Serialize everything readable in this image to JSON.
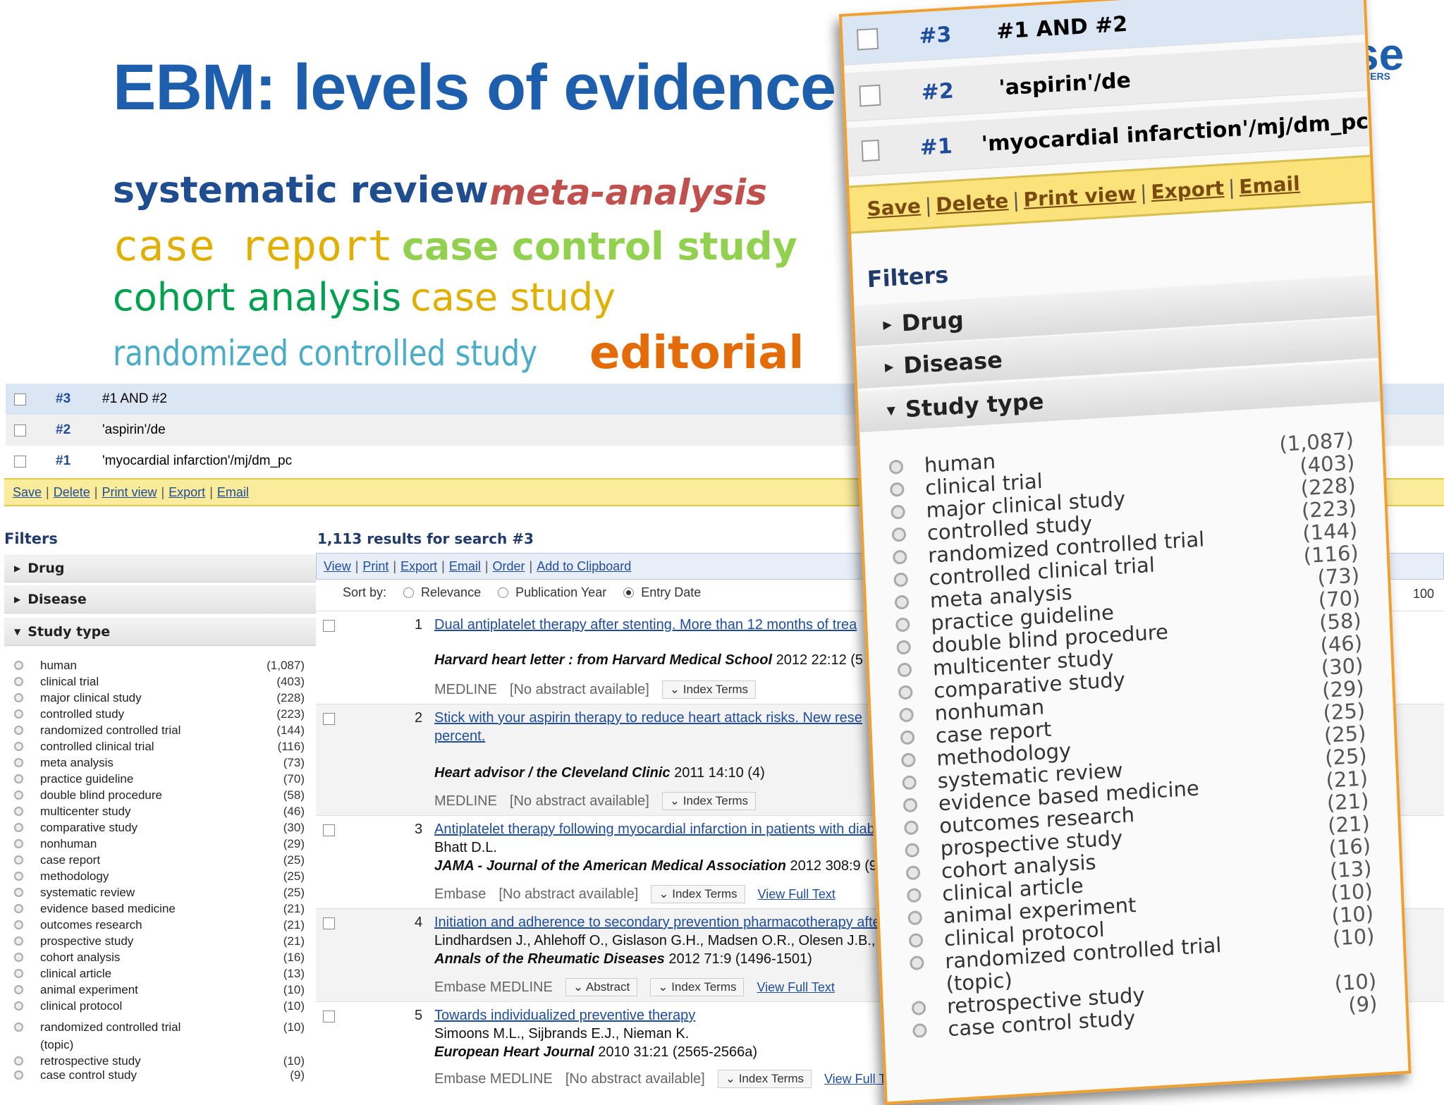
{
  "slide": {
    "title": "EBM: levels of evidence",
    "logo_text": "se",
    "logo_sub": "WERS"
  },
  "words": [
    {
      "text": "systematic review",
      "color": "#1f4d8f"
    },
    {
      "text": "meta-analysis",
      "color": "#c0504d"
    },
    {
      "text": "case report",
      "color": "#e0b000"
    },
    {
      "text": "case control study",
      "color": "#92d050"
    },
    {
      "text": "cohort analysis",
      "color": "#00a050"
    },
    {
      "text": "case study",
      "color": "#e0b000"
    },
    {
      "text": "randomized controlled study",
      "color": "#4bacc6"
    },
    {
      "text": "editorial",
      "color": "#e36c09"
    }
  ],
  "history": [
    {
      "num": "#3",
      "query": "#1 AND #2"
    },
    {
      "num": "#2",
      "query": "'aspirin'/de"
    },
    {
      "num": "#1",
      "query": "'myocardial infarction'/mj/dm_pc"
    }
  ],
  "history_actions": [
    "Save",
    "Delete",
    "Print view",
    "Export",
    "Email"
  ],
  "filters": {
    "heading": "Filters",
    "facets": [
      "Drug",
      "Disease",
      "Study type"
    ]
  },
  "study_types": [
    {
      "label": "human",
      "count": "(1,087)"
    },
    {
      "label": "clinical trial",
      "count": "(403)"
    },
    {
      "label": "major clinical study",
      "count": "(228)"
    },
    {
      "label": "controlled study",
      "count": "(223)"
    },
    {
      "label": "randomized controlled trial",
      "count": "(144)"
    },
    {
      "label": "controlled clinical trial",
      "count": "(116)"
    },
    {
      "label": "meta analysis",
      "count": "(73)"
    },
    {
      "label": "practice guideline",
      "count": "(70)"
    },
    {
      "label": "double blind procedure",
      "count": "(58)"
    },
    {
      "label": "multicenter study",
      "count": "(46)"
    },
    {
      "label": "comparative study",
      "count": "(30)"
    },
    {
      "label": "nonhuman",
      "count": "(29)"
    },
    {
      "label": "case report",
      "count": "(25)"
    },
    {
      "label": "methodology",
      "count": "(25)"
    },
    {
      "label": "systematic review",
      "count": "(25)"
    },
    {
      "label": "evidence based medicine",
      "count": "(21)"
    },
    {
      "label": "outcomes research",
      "count": "(21)"
    },
    {
      "label": "prospective study",
      "count": "(21)"
    },
    {
      "label": "cohort analysis",
      "count": "(16)"
    },
    {
      "label": "clinical article",
      "count": "(13)"
    },
    {
      "label": "animal experiment",
      "count": "(10)"
    },
    {
      "label": "clinical protocol",
      "count": "(10)"
    },
    {
      "label": "randomized controlled trial",
      "count": "(10)"
    },
    {
      "label": "(topic)",
      "count": ""
    },
    {
      "label": "retrospective study",
      "count": "(10)"
    },
    {
      "label": "case control study",
      "count": "(9)"
    }
  ],
  "results": {
    "heading": "1,113 results for search #3",
    "actions": [
      "View",
      "Print",
      "Export",
      "Email",
      "Order",
      "Add to Clipboard"
    ],
    "sort_label": "Sort by:",
    "sort_options": [
      "Relevance",
      "Publication Year",
      "Entry Date"
    ],
    "page_size": "100",
    "items": [
      {
        "n": "1",
        "title": "Dual antiplatelet therapy after stenting. More than 12 months of trea",
        "title2": "",
        "authors": "",
        "journal": "Harvard heart letter : from Harvard Medical School",
        "cite": " 2012 22:12 (5",
        "src": "MEDLINE",
        "abstract": "[No abstract available]",
        "index": "Index Terms",
        "fulltext": ""
      },
      {
        "n": "2",
        "title": "Stick with your aspirin therapy to reduce heart attack risks. New rese",
        "title2": "percent.",
        "authors": "",
        "journal": "Heart advisor / the Cleveland Clinic",
        "cite": " 2011 14:10 (4)",
        "src": "MEDLINE",
        "abstract": "[No abstract available]",
        "index": "Index Terms",
        "fulltext": ""
      },
      {
        "n": "3",
        "title": "Antiplatelet therapy following myocardial infarction in patients with diab",
        "title2": "",
        "authors": "Bhatt D.L.",
        "journal": "JAMA - Journal of the American Medical Association",
        "cite": " 2012 308:9 (9",
        "src": "Embase",
        "abstract": "[No abstract available]",
        "index": "Index Terms",
        "fulltext": "View Full Text"
      },
      {
        "n": "4",
        "title": "Initiation and adherence to secondary prevention pharmacotherapy after r",
        "title2": "",
        "authors": "Lindhardsen J., Ahlehoff O., Gislason G.H., Madsen O.R., Olesen J.B., T",
        "journal": "Annals of the Rheumatic Diseases",
        "cite": " 2012 71:9 (1496-1501)",
        "src": "Embase   MEDLINE",
        "abstract": "Abstract",
        "index": "Index Terms",
        "fulltext": "View Full Text"
      },
      {
        "n": "5",
        "title": "Towards individualized preventive therapy",
        "title2": "",
        "authors": "Simoons M.L., Sijbrands E.J., Nieman K.",
        "journal": "European Heart Journal",
        "cite": " 2010 31:21 (2565-2566a)",
        "src": "Embase   MEDLINE",
        "abstract": "[No abstract available]",
        "index": "Index Terms",
        "fulltext": "View Full Text"
      }
    ]
  }
}
